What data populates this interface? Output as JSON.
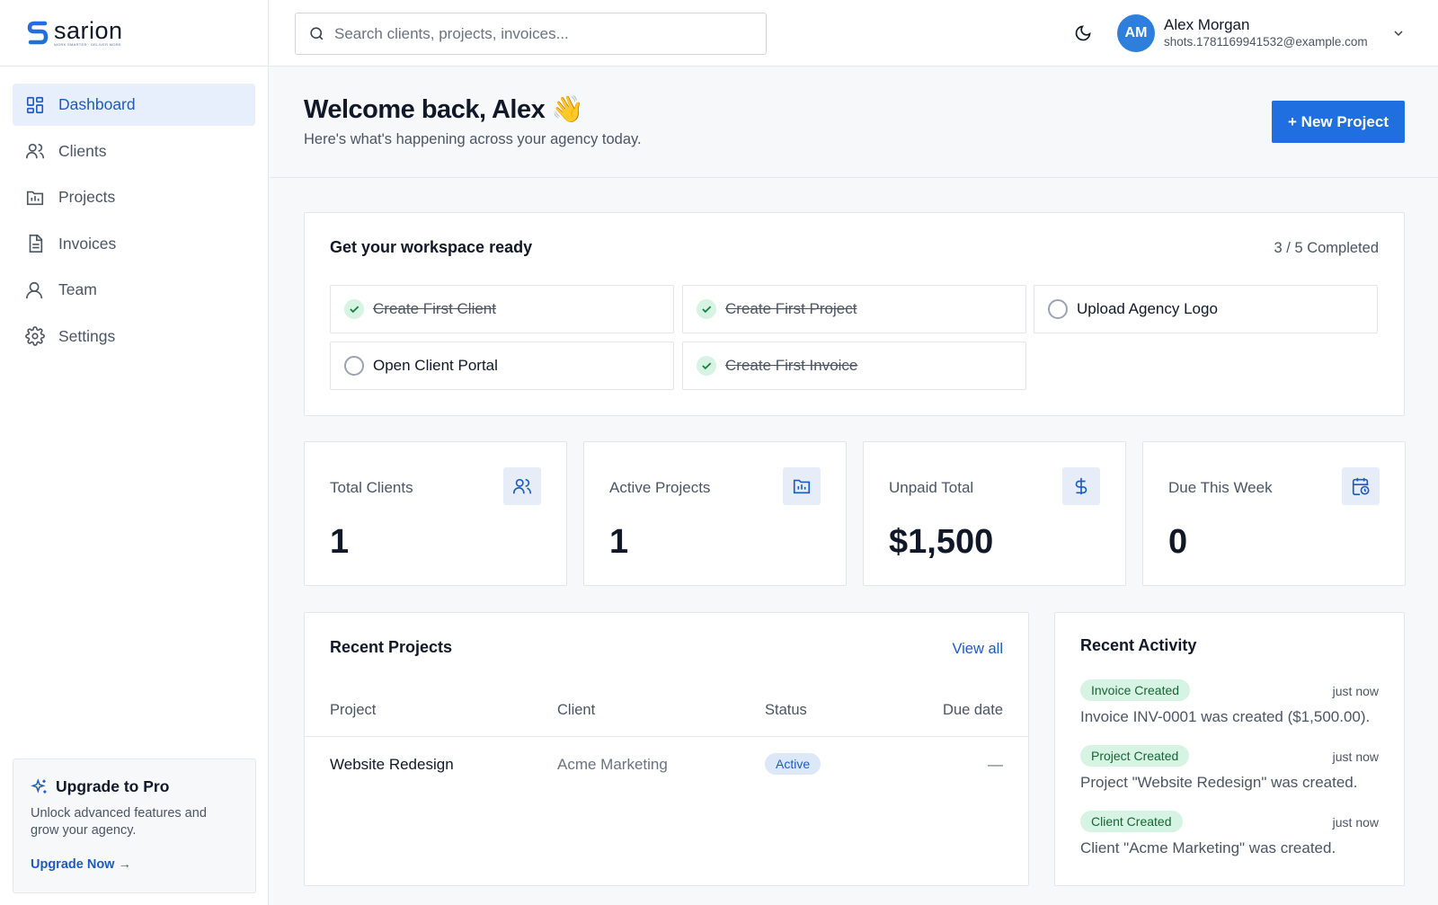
{
  "brand": {
    "name": "sarion",
    "tagline": "WORK SMARTER · DELIVER MORE"
  },
  "sidebar": {
    "items": [
      {
        "label": "Dashboard",
        "icon": "dashboard-icon",
        "active": true
      },
      {
        "label": "Clients",
        "icon": "users-icon"
      },
      {
        "label": "Projects",
        "icon": "folder-chart-icon"
      },
      {
        "label": "Invoices",
        "icon": "document-icon"
      },
      {
        "label": "Team",
        "icon": "user-icon"
      },
      {
        "label": "Settings",
        "icon": "gear-icon"
      }
    ],
    "upgrade": {
      "title": "Upgrade to Pro",
      "description": "Unlock advanced features and grow your agency.",
      "link": "Upgrade Now →"
    }
  },
  "topbar": {
    "search_placeholder": "Search clients, projects, invoices...",
    "user": {
      "initials": "AM",
      "name": "Alex Morgan",
      "email": "shots.1781169941532@example.com"
    }
  },
  "header": {
    "title": "Welcome back, Alex 👋",
    "subtitle": "Here's what's happening across your agency today.",
    "new_project": "+ New Project"
  },
  "workspace": {
    "title": "Get your workspace ready",
    "progress": "3 / 5 Completed",
    "tasks": [
      {
        "label": "Create First Client",
        "done": true
      },
      {
        "label": "Create First Project",
        "done": true
      },
      {
        "label": "Upload Agency Logo",
        "done": false
      },
      {
        "label": "Open Client Portal",
        "done": false
      },
      {
        "label": "Create First Invoice",
        "done": true
      }
    ]
  },
  "stats": [
    {
      "label": "Total Clients",
      "value": "1",
      "icon": "users-icon"
    },
    {
      "label": "Active Projects",
      "value": "1",
      "icon": "folder-chart-icon"
    },
    {
      "label": "Unpaid Total",
      "value": "$1,500",
      "icon": "dollar-icon"
    },
    {
      "label": "Due This Week",
      "value": "0",
      "icon": "calendar-clock-icon"
    }
  ],
  "recent_projects": {
    "title": "Recent Projects",
    "view_all": "View all",
    "columns": [
      "Project",
      "Client",
      "Status",
      "Due date"
    ],
    "rows": [
      {
        "project": "Website Redesign",
        "client": "Acme Marketing",
        "status": "Active",
        "due": "—"
      }
    ]
  },
  "recent_activity": {
    "title": "Recent Activity",
    "items": [
      {
        "tag": "Invoice Created",
        "time": "just now",
        "text": "Invoice INV-0001 was created ($1,500.00)."
      },
      {
        "tag": "Project Created",
        "time": "just now",
        "text": "Project \"Website Redesign\" was created."
      },
      {
        "tag": "Client Created",
        "time": "just now",
        "text": "Client \"Acme Marketing\" was created."
      }
    ]
  },
  "colors": {
    "accent": "#1e5bbf",
    "button": "#1f6fe0",
    "success_bg": "#d6f3e3",
    "success_fg": "#166534"
  }
}
